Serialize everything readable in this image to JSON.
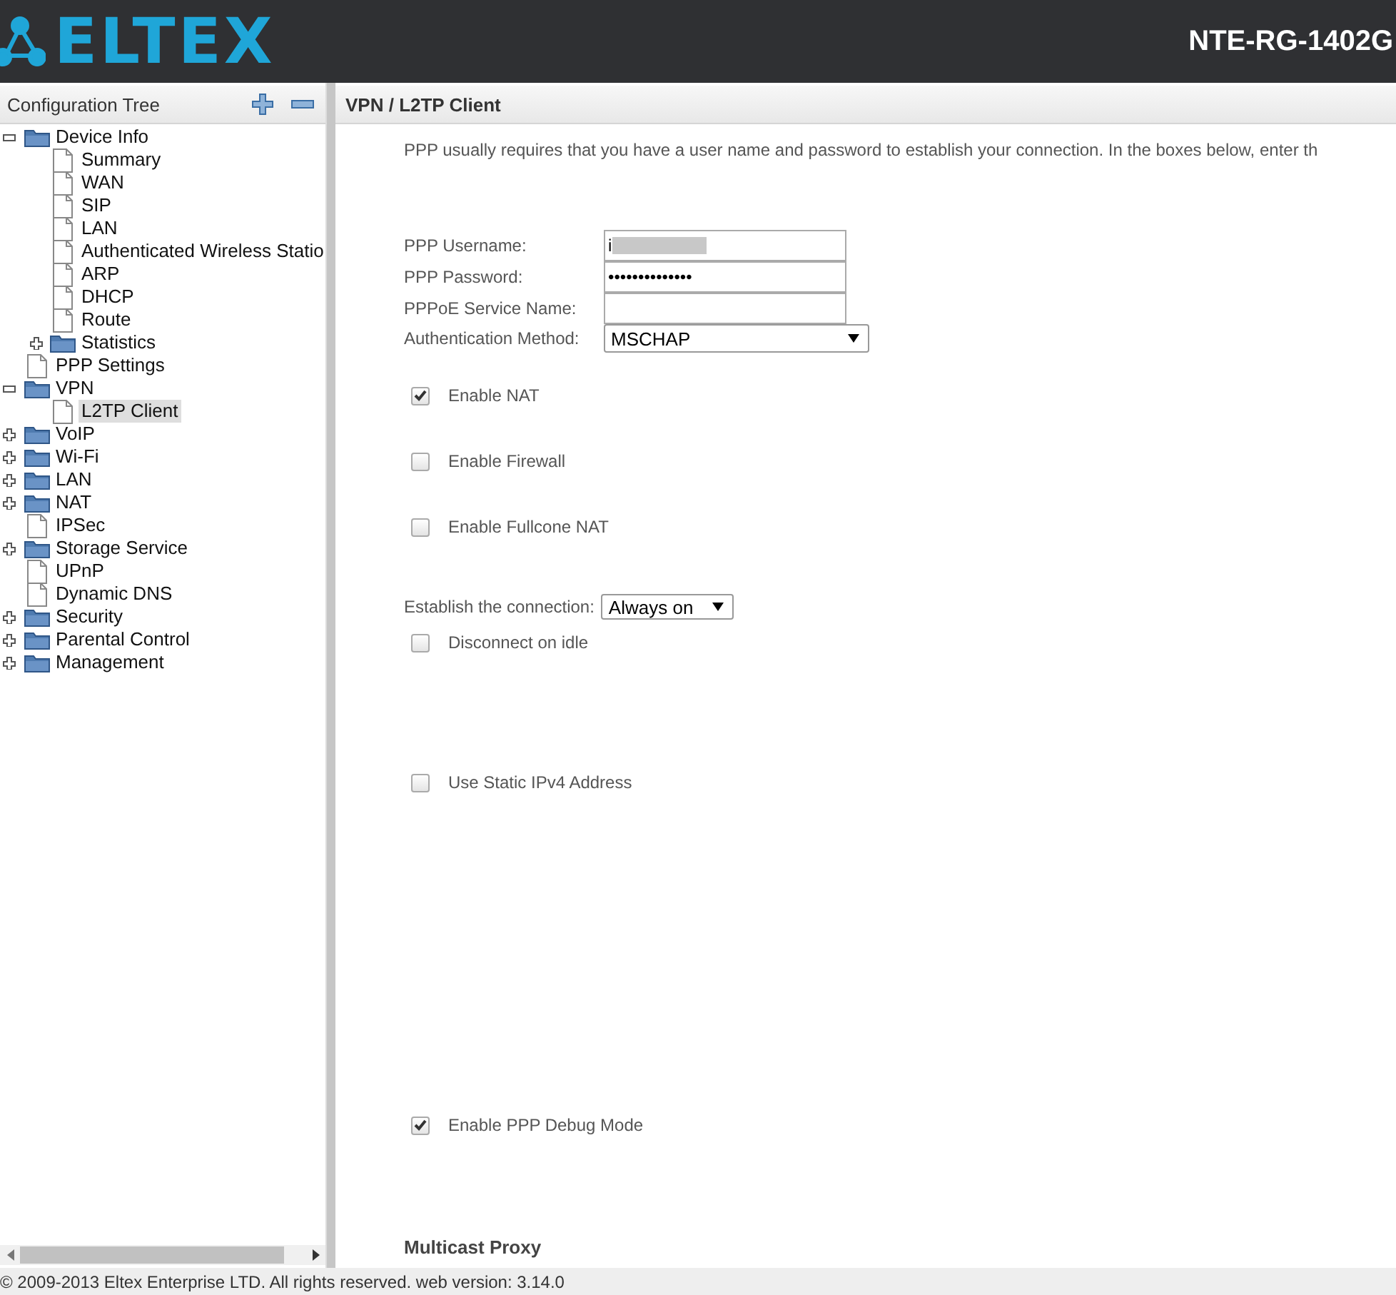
{
  "header": {
    "logo": "ELTEX",
    "model": "NTE-RG-1402G"
  },
  "sidebar": {
    "title": "Configuration Tree",
    "tree": [
      {
        "label": "Device Info",
        "kind": "folder",
        "expanded": true,
        "selected": false,
        "children": [
          {
            "label": "Summary",
            "kind": "page",
            "selected": false
          },
          {
            "label": "WAN",
            "kind": "page",
            "selected": false
          },
          {
            "label": "SIP",
            "kind": "page",
            "selected": false
          },
          {
            "label": "LAN",
            "kind": "page",
            "selected": false
          },
          {
            "label": "Authenticated Wireless Statio",
            "kind": "page",
            "selected": false
          },
          {
            "label": "ARP",
            "kind": "page",
            "selected": false
          },
          {
            "label": "DHCP",
            "kind": "page",
            "selected": false
          },
          {
            "label": "Route",
            "kind": "page",
            "selected": false
          },
          {
            "label": "Statistics",
            "kind": "folder",
            "expanded": false,
            "selected": false
          }
        ]
      },
      {
        "label": "PPP Settings",
        "kind": "page",
        "selected": false
      },
      {
        "label": "VPN",
        "kind": "folder",
        "expanded": true,
        "selected": false,
        "children": [
          {
            "label": "L2TP Client",
            "kind": "page",
            "selected": true
          }
        ]
      },
      {
        "label": "VoIP",
        "kind": "folder",
        "expanded": false,
        "selected": false
      },
      {
        "label": "Wi-Fi",
        "kind": "folder",
        "expanded": false,
        "selected": false
      },
      {
        "label": "LAN",
        "kind": "folder",
        "expanded": false,
        "selected": false
      },
      {
        "label": "NAT",
        "kind": "folder",
        "expanded": false,
        "selected": false
      },
      {
        "label": "IPSec",
        "kind": "page",
        "selected": false
      },
      {
        "label": "Storage Service",
        "kind": "folder",
        "expanded": false,
        "selected": false
      },
      {
        "label": "UPnP",
        "kind": "page",
        "selected": false
      },
      {
        "label": "Dynamic DNS",
        "kind": "page",
        "selected": false
      },
      {
        "label": "Security",
        "kind": "folder",
        "expanded": false,
        "selected": false
      },
      {
        "label": "Parental Control",
        "kind": "folder",
        "expanded": false,
        "selected": false
      },
      {
        "label": "Management",
        "kind": "folder",
        "expanded": false,
        "selected": false
      }
    ]
  },
  "main": {
    "title": "VPN / L2TP Client",
    "items": [
      {
        "kind": "text",
        "text": "PPP usually requires that you have a user name and password to establish your connection. In the boxes below, enter th"
      },
      {
        "kind": "field",
        "label": "PPP Username:",
        "value": "i",
        "redacted": true
      },
      {
        "kind": "field",
        "label": "PPP Password:",
        "value": "••••••••••••••"
      },
      {
        "kind": "field",
        "label": "PPPoE Service Name:"
      },
      {
        "kind": "select",
        "label": "Authentication Method:",
        "value": "MSCHAP"
      },
      {
        "kind": "checkbox",
        "label": "Enable NAT",
        "checked": true
      },
      {
        "kind": "checkbox",
        "label": "Enable Firewall",
        "checked": false
      },
      {
        "kind": "checkbox",
        "label": "Enable Fullcone NAT",
        "checked": false
      },
      {
        "kind": "select",
        "label": "Establish the connection:",
        "value": "Always on"
      },
      {
        "kind": "checkbox",
        "label": "Disconnect on idle",
        "checked": false
      },
      {
        "kind": "checkbox",
        "label": "Use Static IPv4 Address",
        "checked": false
      },
      {
        "kind": "checkbox",
        "label": "Enable PPP Debug Mode",
        "checked": true
      },
      {
        "kind": "heading",
        "text": "Multicast Proxy"
      }
    ]
  },
  "footer": "© 2009-2013 Eltex Enterprise LTD. All rights reserved. web version: 3.14.0"
}
